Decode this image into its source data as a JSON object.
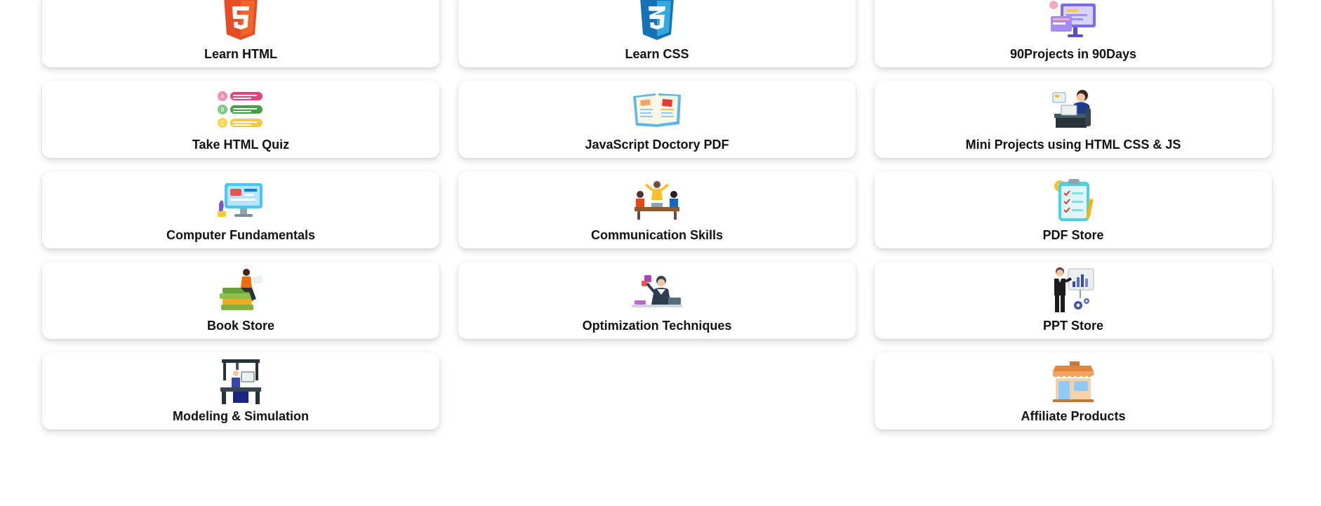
{
  "cards": [
    {
      "label": "Learn HTML",
      "icon": "html5-icon"
    },
    {
      "label": "Learn CSS",
      "icon": "css3-icon"
    },
    {
      "label": "90Projects in 90Days",
      "icon": "projects-dashboard-icon"
    },
    {
      "label": "Take HTML Quiz",
      "icon": "quiz-options-icon"
    },
    {
      "label": "JavaScript Doctory PDF",
      "icon": "open-book-icon"
    },
    {
      "label": "Mini Projects using HTML CSS & JS",
      "icon": "person-at-laptop-icon"
    },
    {
      "label": "Computer Fundamentals",
      "icon": "computer-monitor-icon"
    },
    {
      "label": "Communication Skills",
      "icon": "team-meeting-icon"
    },
    {
      "label": "PDF Store",
      "icon": "clipboard-checklist-icon"
    },
    {
      "label": "Book Store",
      "icon": "reading-on-books-icon"
    },
    {
      "label": "Optimization Techniques",
      "icon": "businessman-desk-icon"
    },
    {
      "label": "PPT Store",
      "icon": "presenter-board-icon"
    },
    {
      "label": "Modeling & Simulation",
      "icon": "simulation-machine-icon"
    },
    {
      "label": "Affiliate Products",
      "icon": "storefront-icon"
    }
  ]
}
